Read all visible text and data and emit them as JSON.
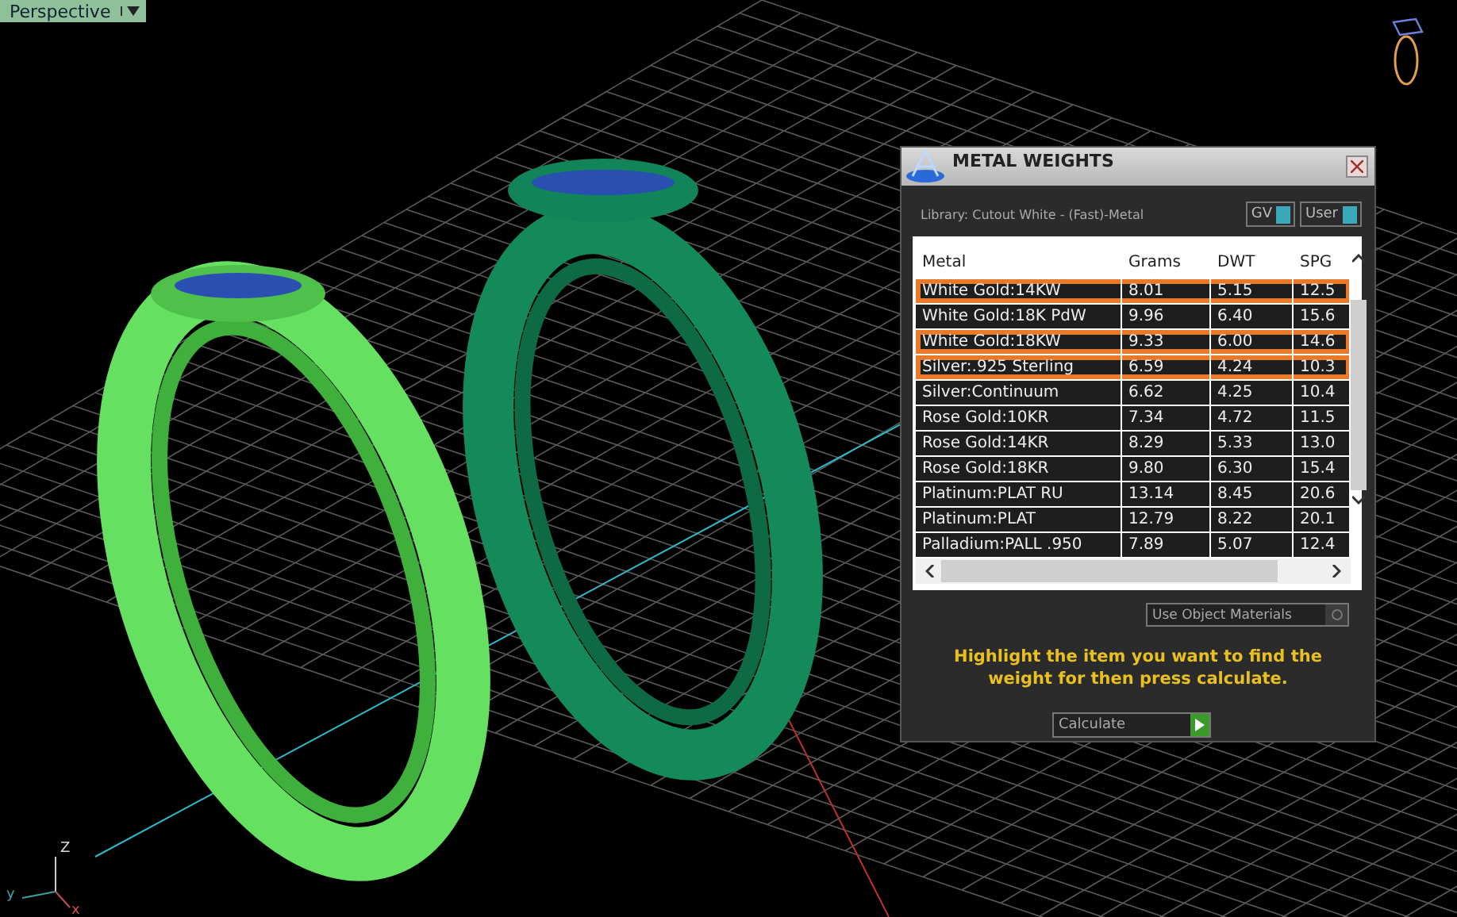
{
  "viewport": {
    "label": "Perspective"
  },
  "axes": {
    "z": "Z",
    "y": "y",
    "x": "x"
  },
  "dialog": {
    "title": "METAL WEIGHTS",
    "library": "Library: Cutout White - (Fast)-Metal",
    "toggles": [
      {
        "label": "GV",
        "on": true
      },
      {
        "label": "User",
        "on": true
      }
    ],
    "table": {
      "columns": [
        "Metal",
        "Grams",
        "DWT",
        "SPG"
      ],
      "rows": [
        {
          "cells": [
            "White Gold:14KW",
            "8.01",
            "5.15",
            "12.5"
          ],
          "highlighted": true
        },
        {
          "cells": [
            "White Gold:18K PdW",
            "9.96",
            "6.40",
            "15.6"
          ],
          "highlighted": false
        },
        {
          "cells": [
            "White Gold:18KW",
            "9.33",
            "6.00",
            "14.6"
          ],
          "highlighted": true
        },
        {
          "cells": [
            "Silver:.925 Sterling",
            "6.59",
            "4.24",
            "10.3"
          ],
          "highlighted": true
        },
        {
          "cells": [
            "Silver:Continuum",
            "6.62",
            "4.25",
            "10.4"
          ],
          "highlighted": false
        },
        {
          "cells": [
            "Rose Gold:10KR",
            "7.34",
            "4.72",
            "11.5"
          ],
          "highlighted": false
        },
        {
          "cells": [
            "Rose Gold:14KR",
            "8.29",
            "5.33",
            "13.0"
          ],
          "highlighted": false
        },
        {
          "cells": [
            "Rose Gold:18KR",
            "9.80",
            "6.30",
            "15.4"
          ],
          "highlighted": false
        },
        {
          "cells": [
            "Platinum:PLAT RU",
            "13.14",
            "8.45",
            "20.6"
          ],
          "highlighted": false
        },
        {
          "cells": [
            "Platinum:PLAT",
            "12.79",
            "8.22",
            "20.1"
          ],
          "highlighted": false
        },
        {
          "cells": [
            "Palladium:PALL .950",
            "7.89",
            "5.07",
            "12.4"
          ],
          "highlighted": false
        }
      ]
    },
    "use_object_materials": {
      "label": "Use Object Materials",
      "checked": false
    },
    "hint": "Highlight the item you want to find the weight for then press calculate.",
    "button": "Calculate"
  }
}
